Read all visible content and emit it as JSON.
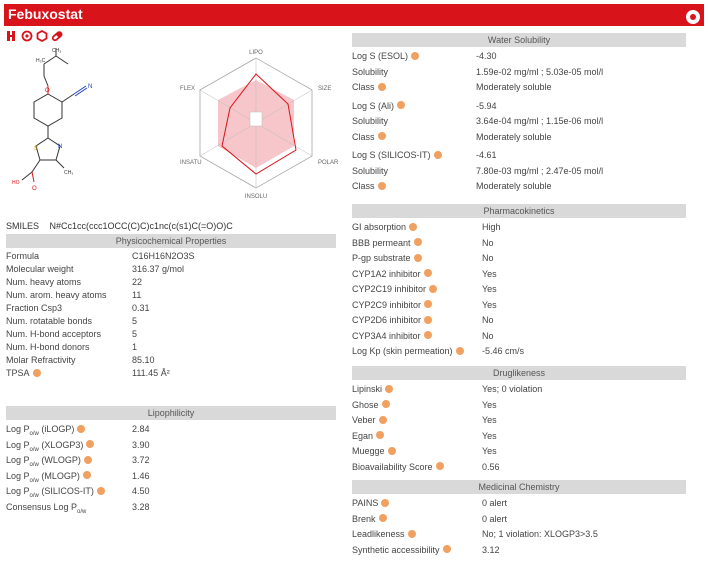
{
  "header": {
    "title": "Febuxostat"
  },
  "smiles": {
    "label": "SMILES",
    "value": "N#Cc1cc(ccc1OCC(C)C)c1nc(c(s1)C(=O)O)C"
  },
  "radar": {
    "labels": [
      "LIPO",
      "SIZE",
      "POLAR",
      "INSOLU",
      "INSATU",
      "FLEX"
    ]
  },
  "physchem": {
    "header": "Physicochemical Properties",
    "rows": [
      {
        "k": "Formula",
        "v": "C16H16N2O3S"
      },
      {
        "k": "Molecular weight",
        "v": "316.37 g/mol"
      },
      {
        "k": "Num. heavy atoms",
        "v": "22"
      },
      {
        "k": "Num. arom. heavy atoms",
        "v": "11"
      },
      {
        "k": "Fraction Csp3",
        "v": "0.31"
      },
      {
        "k": "Num. rotatable bonds",
        "v": "5"
      },
      {
        "k": "Num. H-bond acceptors",
        "v": "5"
      },
      {
        "k": "Num. H-bond donors",
        "v": "1"
      },
      {
        "k": "Molar Refractivity",
        "v": "85.10"
      },
      {
        "k": "TPSA",
        "v": "111.45 Å²"
      }
    ]
  },
  "lipo": {
    "header": "Lipophilicity",
    "rows": [
      {
        "k": "(iLOGP)",
        "v": "2.84"
      },
      {
        "k": "(XLOGP3)",
        "v": "3.90"
      },
      {
        "k": "(WLOGP)",
        "v": "3.72"
      },
      {
        "k": "(MLOGP)",
        "v": "1.46"
      },
      {
        "k": "(SILICOS-IT)",
        "v": "4.50"
      }
    ],
    "logp_prefix": "Log P",
    "logp_sub": "o/w",
    "consensus_label": "Consensus Log P",
    "consensus_value": "3.28"
  },
  "water": {
    "header": "Water Solubility",
    "blocks": [
      {
        "title": "Log S (ESOL)",
        "logs": "-4.30",
        "sol": "1.59e-02 mg/ml ; 5.03e-05 mol/l",
        "cls": "Moderately soluble"
      },
      {
        "title": "Log S (Ali)",
        "logs": "-5.94",
        "sol": "3.64e-04 mg/ml ; 1.15e-06 mol/l",
        "cls": "Moderately soluble"
      },
      {
        "title": "Log S (SILICOS-IT)",
        "logs": "-4.61",
        "sol": "7.80e-03 mg/ml ; 2.47e-05 mol/l",
        "cls": "Moderately soluble"
      }
    ],
    "sol_label": "Solubility",
    "cls_label": "Class"
  },
  "pk": {
    "header": "Pharmacokinetics",
    "rows": [
      {
        "k": "GI absorption",
        "v": "High"
      },
      {
        "k": "BBB permeant",
        "v": "No"
      },
      {
        "k": "P-gp substrate",
        "v": "No"
      },
      {
        "k": "CYP1A2 inhibitor",
        "v": "Yes"
      },
      {
        "k": "CYP2C19 inhibitor",
        "v": "Yes"
      },
      {
        "k": "CYP2C9 inhibitor",
        "v": "Yes"
      },
      {
        "k": "CYP2D6 inhibitor",
        "v": "No"
      },
      {
        "k": "CYP3A4 inhibitor",
        "v": "No"
      },
      {
        "k": "Log Kp (skin permeation)",
        "v": "-5.46 cm/s"
      }
    ]
  },
  "drug": {
    "header": "Druglikeness",
    "rows": [
      {
        "k": "Lipinski",
        "v": "Yes; 0 violation"
      },
      {
        "k": "Ghose",
        "v": "Yes"
      },
      {
        "k": "Veber",
        "v": "Yes"
      },
      {
        "k": "Egan",
        "v": "Yes"
      },
      {
        "k": "Muegge",
        "v": "Yes"
      },
      {
        "k": "Bioavailability Score",
        "v": "0.56"
      }
    ]
  },
  "medchem": {
    "header": "Medicinal Chemistry",
    "rows": [
      {
        "k": "PAINS",
        "v": "0 alert"
      },
      {
        "k": "Brenk",
        "v": "0 alert"
      },
      {
        "k": "Leadlikeness",
        "v": "No; 1 violation: XLOGP3>3.5"
      },
      {
        "k": "Synthetic accessibility",
        "v": "3.12"
      }
    ]
  },
  "colors": {
    "brand": "#d8141a",
    "header_bg": "#d9d9d9",
    "radar_fill": "#f4b8bd",
    "info": "#f0a060"
  }
}
